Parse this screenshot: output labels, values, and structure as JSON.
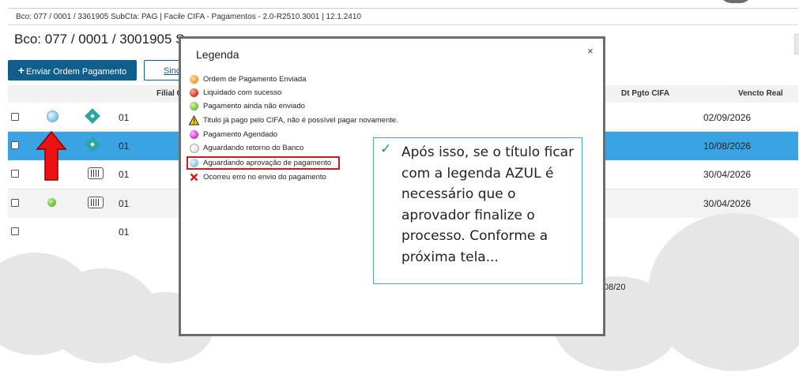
{
  "window_title": "Bco: 077 / 0001  / 3361905 SubCta: PAG | Facile CIFA - Pagamentos - 2.0-R2510.3001 | 12.1.2410",
  "page_header": "Bco: 077 / 0001  / 3001905 S",
  "buttons": {
    "enviar_ordem": "Enviar Ordem Pagamento",
    "enviar_plus": "+",
    "secondary": "Sinc"
  },
  "table": {
    "headers": {
      "filial": "Filial C",
      "dt_pgto_cifa": "Dt Pgto CIFA",
      "vencto_real": "Vencto Real"
    },
    "rows": [
      {
        "num": "01",
        "status_color": "#8fc9ea",
        "type_icon": "diamond-icon",
        "date": "02/09/2026",
        "selected": false
      },
      {
        "num": "01",
        "status_color": "#8fc9ea",
        "type_icon": "diamond-icon",
        "date": "10/08/2026",
        "selected": true
      },
      {
        "num": "01",
        "status_color": "#9fd86b",
        "type_icon": "barcode-icon",
        "date": "30/04/2026",
        "selected": false
      },
      {
        "num": "01",
        "status_color": "#76c442",
        "type_icon": "barcode-icon",
        "date": "30/04/2026",
        "selected": false
      },
      {
        "num": "01",
        "status_color": "",
        "type_icon": "",
        "date": "",
        "selected": false
      }
    ],
    "peek_text": "08/20"
  },
  "modal": {
    "title": "Legenda",
    "close": "×",
    "items": [
      {
        "label": "Ordem de Pagamento Enviada",
        "icon": "orange-ball-icon",
        "color": "#f0a33c"
      },
      {
        "label": "Liquidado com sucesso",
        "icon": "red-ball-icon",
        "color": "#e23b2e"
      },
      {
        "label": "Pagamento ainda não enviado",
        "icon": "green-ball-icon",
        "color": "#7cc544"
      },
      {
        "label": "Titulo já pago pelo CIFA, não é possível pagar novamente.",
        "icon": "warning-triangle-icon",
        "color": "#f5d000"
      },
      {
        "label": "Pagamento Agendado",
        "icon": "magenta-ball-icon",
        "color": "#d53fd0"
      },
      {
        "label": "Aguardando retorno do Banco",
        "icon": "white-ball-icon",
        "color": "#f2f2f2"
      },
      {
        "label": "Aguardando aprovação de pagamento",
        "icon": "blue-ball-icon",
        "color": "#8fc9ea"
      },
      {
        "label": "Ocorreu erro no envio do pagamento",
        "icon": "red-x-icon",
        "color": "#d11a1a"
      }
    ]
  },
  "note": {
    "check": "✓",
    "text": "Após isso, se o título ficar com a legenda AZUL é necessário que o aprovador finalize o processo. Conforme a próxima tela..."
  },
  "colors": {
    "accent": "#0f5e8c",
    "selected_row": "#3aa3e3",
    "highlight_red": "#d11a1a",
    "note_border": "#4aa3c8"
  }
}
